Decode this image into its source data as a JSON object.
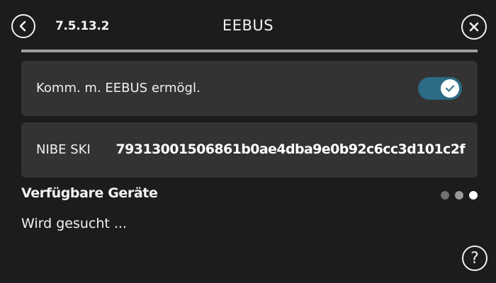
{
  "header": {
    "menu_number": "7.5.13.2",
    "title": "EEBUS",
    "back_icon": "chevron-left-icon",
    "close_icon": "close-icon"
  },
  "settings": {
    "eebus_toggle": {
      "label": "Komm. m. EEBUS ermögl.",
      "enabled": true,
      "accent_color": "#2d6b86"
    },
    "ski": {
      "label": "NIBE SKI",
      "value": "79313001506861b0ae4dba9e0b92c6cc3d101c2f"
    }
  },
  "devices": {
    "title": "Verfügbare Geräte",
    "status": "Wird gesucht ...",
    "page_count": 3,
    "active_page": 3
  },
  "footer": {
    "help_glyph": "?",
    "help_icon": "help-icon"
  }
}
